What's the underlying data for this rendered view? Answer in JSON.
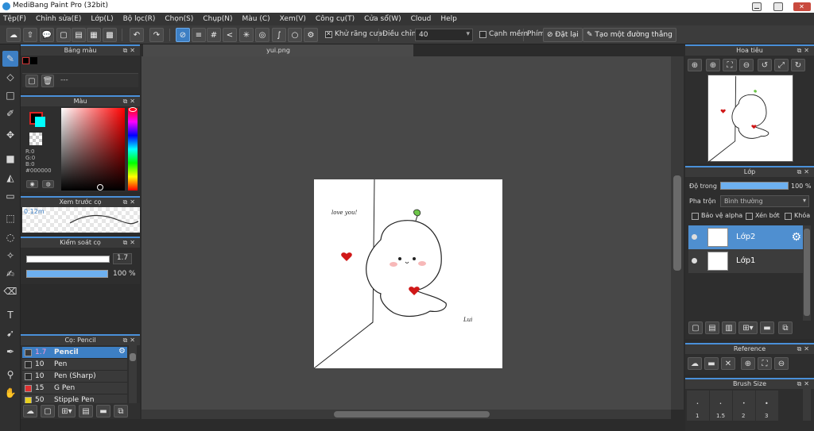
{
  "window": {
    "title": "MediBang Paint Pro (32bit)"
  },
  "menu": [
    "Tệp(F)",
    "Chỉnh sửa(E)",
    "Lớp(L)",
    "Bộ lọc(R)",
    "Chọn(S)",
    "Chụp(N)",
    "Màu (C)",
    "Xem(V)",
    "Công cụ(T)",
    "Cửa sổ(W)",
    "Cloud",
    "Help"
  ],
  "toolbar": {
    "antialias_label": "Khử răng cưa",
    "adjust_label": "Điều chỉnh",
    "adjust_value": "40",
    "edge_label": "Cạnh mềm",
    "key_label": "Phím",
    "reset_label": "Đặt lại",
    "straight_line_label": "Tạo một đường thẳng"
  },
  "panels": {
    "palette": {
      "title": "Bảng màu",
      "sub": "---"
    },
    "color": {
      "title": "Màu",
      "r": "R:0",
      "g": "G:0",
      "b": "B:0",
      "hex": "#000000"
    },
    "brush_preview": {
      "title": "Xem trước cọ",
      "size": "0.12m"
    },
    "brush_control": {
      "title": "Kiểm soát cọ",
      "size_value": "1.7",
      "opacity_value": "100 %"
    },
    "brushes": {
      "title": "Cọ: Pencil",
      "items": [
        {
          "size": "1.7",
          "name": "Pencil",
          "color": "#3a3a3a"
        },
        {
          "size": "10",
          "name": "Pen",
          "color": "#2a2a2a"
        },
        {
          "size": "10",
          "name": "Pen (Sharp)",
          "color": "#2a2a2a"
        },
        {
          "size": "15",
          "name": "G Pen",
          "color": "#e03030"
        },
        {
          "size": "50",
          "name": "Stipple Pen",
          "color": "#e8d020"
        }
      ]
    },
    "navigator": {
      "title": "Hoa tiêu"
    },
    "layers": {
      "title": "Lớp",
      "opacity_label": "Độ trong",
      "opacity_value": "100 %",
      "blend_label": "Pha trộn",
      "blend_value": "Bình thường",
      "protect_alpha": "Bảo vệ alpha",
      "clipping": "Xén bớt",
      "lock": "Khóa",
      "items": [
        {
          "name": "Lớp2"
        },
        {
          "name": "Lớp1"
        }
      ]
    },
    "reference": {
      "title": "Reference"
    },
    "brush_size": {
      "title": "Brush Size",
      "sizes": [
        "1",
        "1.5",
        "2",
        "3"
      ]
    }
  },
  "canvas": {
    "tab": "yui.png",
    "text_love": "love you!",
    "text_sign": "Lui",
    "zoom_progress": 0.37
  },
  "colors": {
    "accent": "#3d7fc4",
    "foreground": "#000000",
    "background": "#00ffff"
  }
}
